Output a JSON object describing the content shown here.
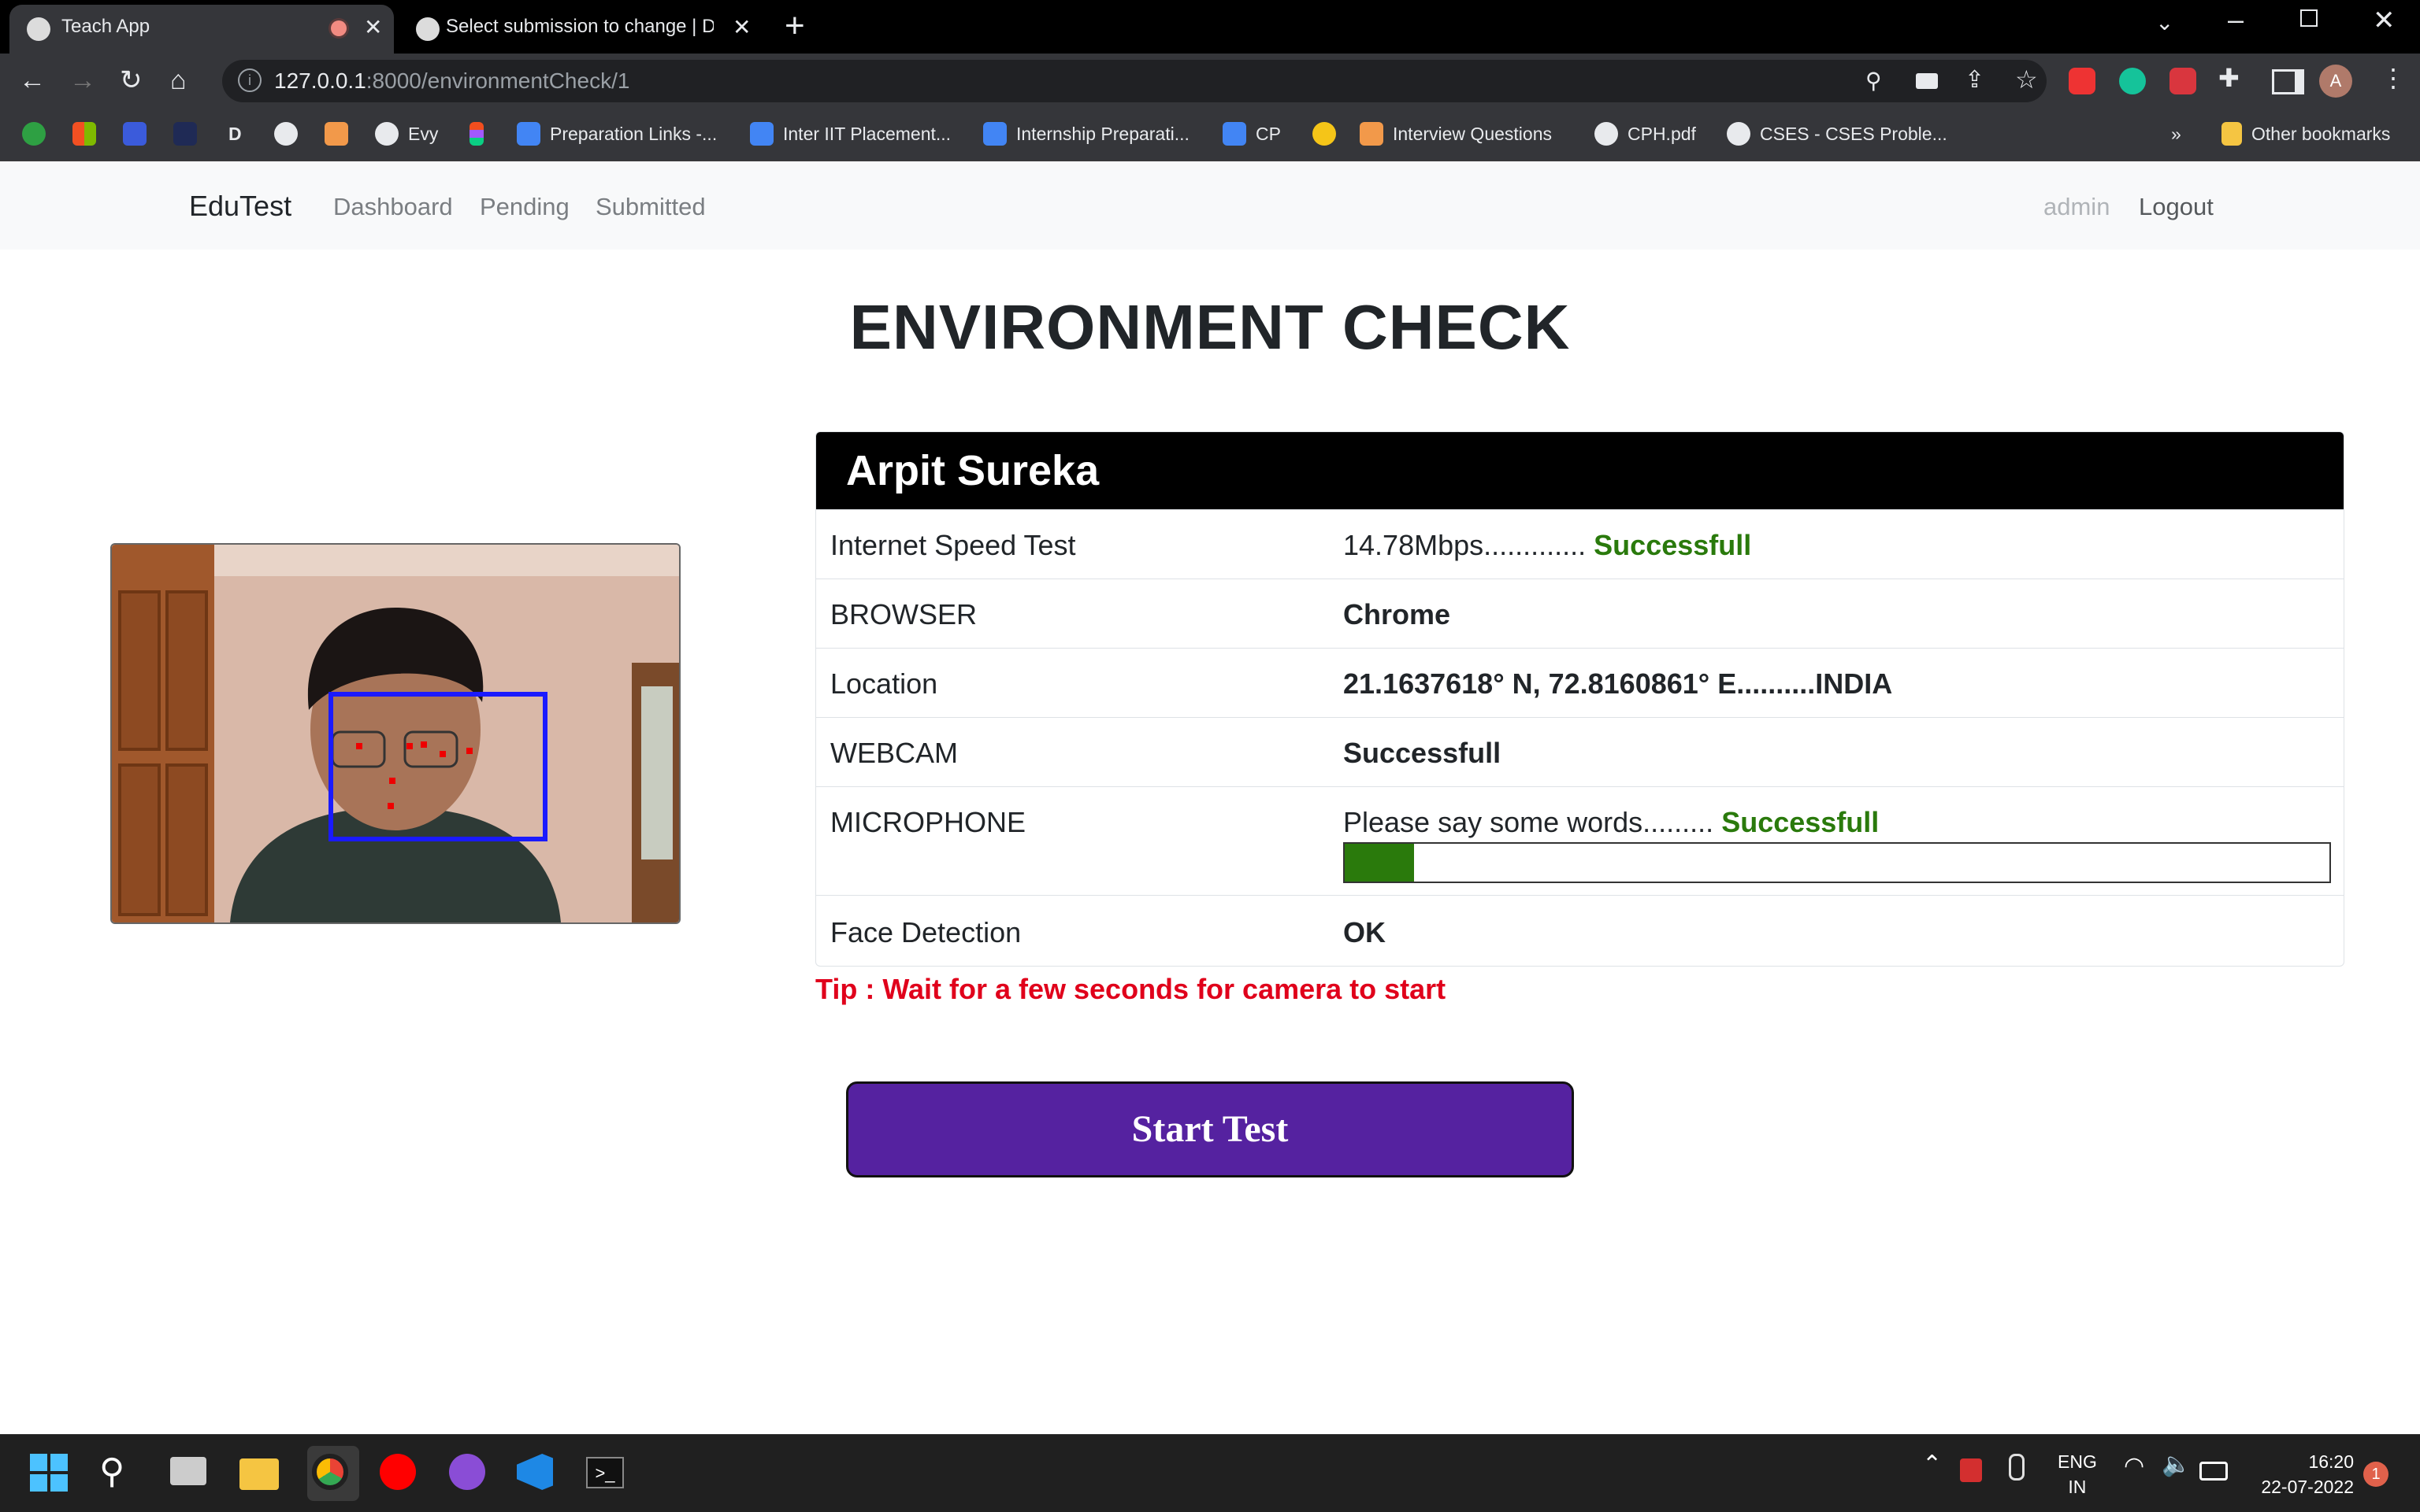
{
  "browser": {
    "tabs": [
      {
        "title": "Teach App",
        "active": true
      },
      {
        "title": "Select submission to change | Dj",
        "active": false
      }
    ],
    "new_tab_label": "+",
    "url_host": "127.0.0.1",
    "url_path": ":8000/environmentCheck/1",
    "profile_initial": "A",
    "bookmarks": [
      {
        "label": "",
        "icon": "notification-icon"
      },
      {
        "label": "",
        "icon": "microsoft-icon"
      },
      {
        "label": "",
        "icon": "app-icon"
      },
      {
        "label": "",
        "icon": "app-icon"
      },
      {
        "label": "D",
        "icon": "d-icon"
      },
      {
        "label": "",
        "icon": "github-icon"
      },
      {
        "label": "",
        "icon": "coding-icon"
      },
      {
        "label": "Evy",
        "icon": "github-icon"
      },
      {
        "label": "",
        "icon": "figma-icon"
      },
      {
        "label": "Preparation Links -...",
        "icon": "doc-icon"
      },
      {
        "label": "Inter IIT Placement...",
        "icon": "doc-icon"
      },
      {
        "label": "Internship Preparati...",
        "icon": "doc-icon"
      },
      {
        "label": "CP",
        "icon": "doc-icon"
      },
      {
        "label": "",
        "icon": "app-icon"
      },
      {
        "label": "Interview Questions",
        "icon": "coding-icon"
      },
      {
        "label": "CPH.pdf",
        "icon": "globe-icon"
      },
      {
        "label": "CSES - CSES Proble...",
        "icon": "globe-icon"
      }
    ],
    "bookmarks_overflow": "»",
    "other_bookmarks": "Other bookmarks"
  },
  "navbar": {
    "brand": "EduTest",
    "links": [
      "Dashboard",
      "Pending",
      "Submitted"
    ],
    "user": "admin",
    "logout": "Logout"
  },
  "page": {
    "title": "ENVIRONMENT CHECK",
    "student_name": "Arpit Sureka",
    "checks": {
      "internet": {
        "label": "Internet Speed Test",
        "value": "14.78Mbps.............",
        "status": "Successfull"
      },
      "browser": {
        "label": "BROWSER",
        "status": "Chrome"
      },
      "location": {
        "label": "Location",
        "status": "21.1637618° N, 72.8160861° E..........INDIA"
      },
      "webcam": {
        "label": "WEBCAM",
        "status": "Successfull"
      },
      "microphone": {
        "label": "MICROPHONE",
        "value": "Please say some words.........",
        "status": "Successfull",
        "level": 0.07
      },
      "face": {
        "label": "Face Detection",
        "status": "OK"
      }
    },
    "tip": "Tip : Wait for a few seconds for camera to start",
    "start_button": "Start Test"
  },
  "taskbar": {
    "lang_top": "ENG",
    "lang_bottom": "IN",
    "time": "16:20",
    "date": "22-07-2022",
    "notification_count": "1"
  },
  "colors": {
    "success": "#2a7a0c",
    "tip": "#e0001b",
    "button": "#5522a0",
    "header": "#000000"
  }
}
